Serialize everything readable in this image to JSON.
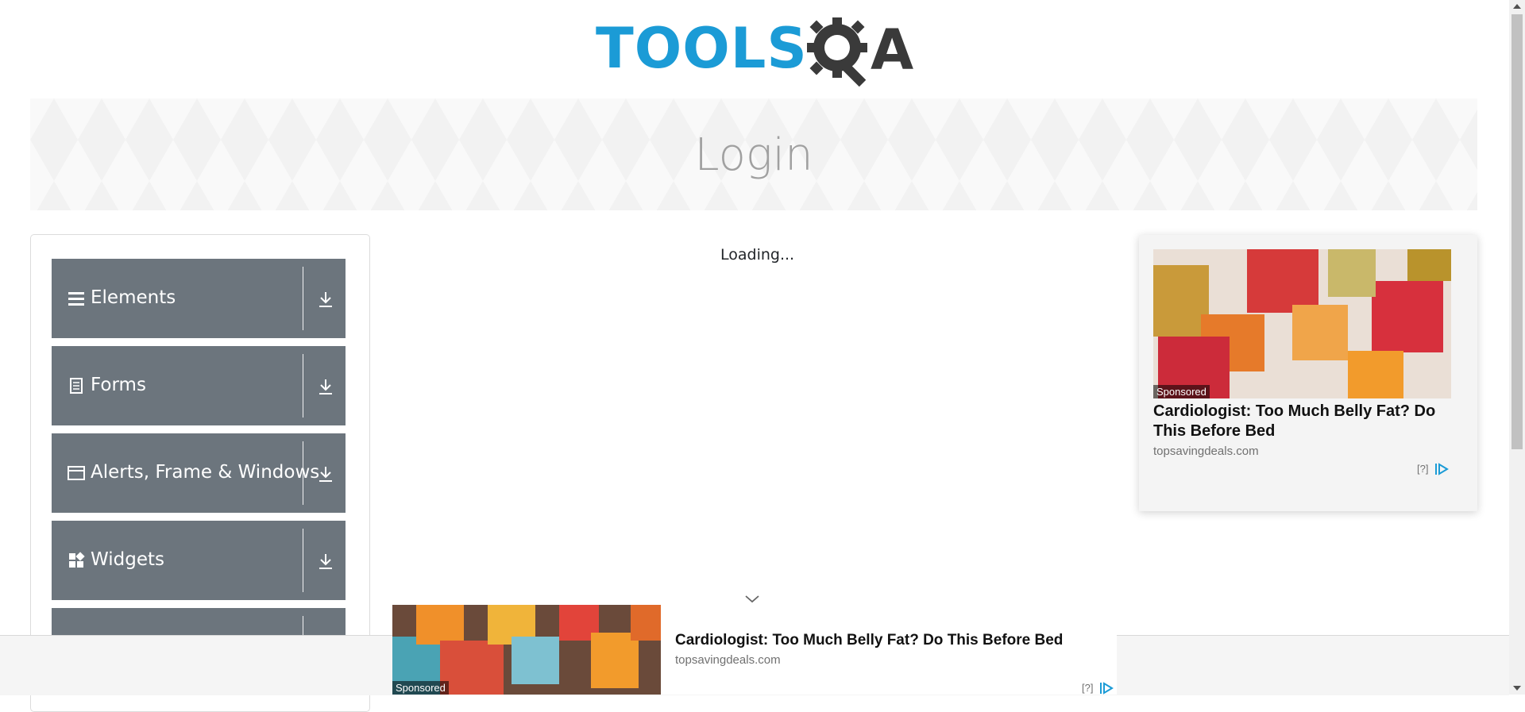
{
  "header": {
    "logo_text": "TOOLS",
    "logo_text_right": "A"
  },
  "banner": {
    "title": "Login"
  },
  "sidebar": {
    "items": [
      {
        "label": "Elements",
        "icon": "list-icon"
      },
      {
        "label": "Forms",
        "icon": "form-icon"
      },
      {
        "label": "Alerts, Frame & Windows",
        "icon": "window-icon"
      },
      {
        "label": "Widgets",
        "icon": "widgets-icon"
      }
    ]
  },
  "main": {
    "loading_text": "Loading..."
  },
  "right_ad": {
    "sponsored": "Sponsored",
    "title": "Cardiologist: Too Much Belly Fat? Do This Before Bed",
    "domain": "topsavingdeals.com",
    "info": "[?]"
  },
  "bottom_ad": {
    "sponsored": "Sponsored",
    "title": "Cardiologist: Too Much Belly Fat? Do This Before Bed",
    "domain": "topsavingdeals.com",
    "info": "[?]"
  },
  "colors": {
    "menu_bg": "#6c757d",
    "logo_blue": "#1b9bd6",
    "logo_dark": "#3a3a3a"
  }
}
